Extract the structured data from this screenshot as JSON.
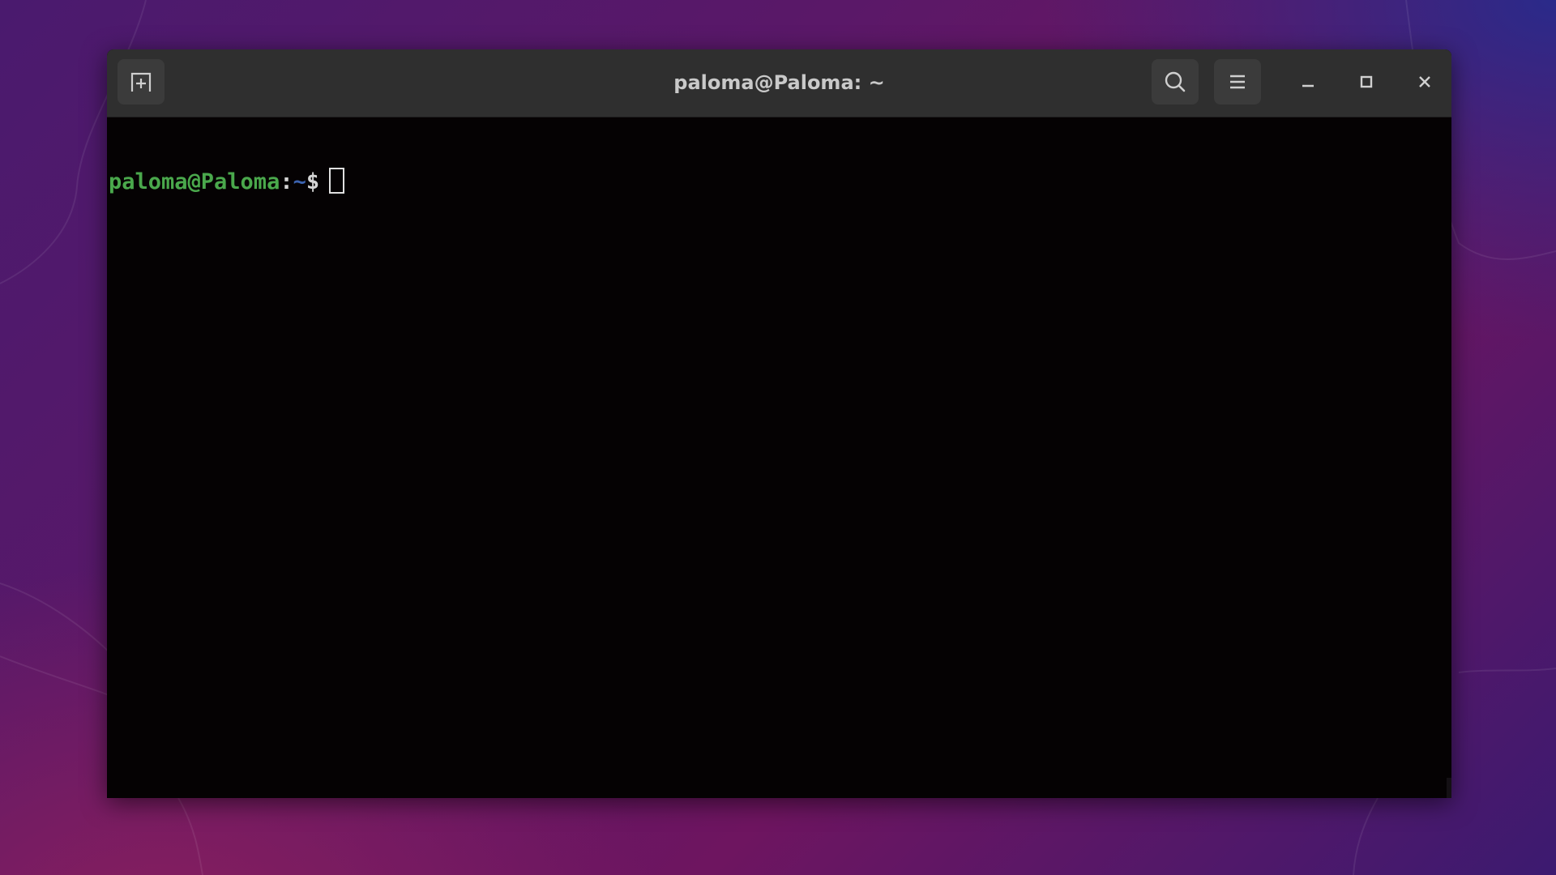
{
  "window": {
    "title": "paloma@Paloma: ~"
  },
  "headerbar": {
    "icons": {
      "new_tab": "new-tab-icon",
      "search": "search-icon",
      "menu": "hamburger-menu-icon",
      "minimize": "minimize-icon",
      "maximize": "maximize-icon",
      "close": "close-icon"
    }
  },
  "terminal": {
    "prompt": {
      "user_host": "paloma@Paloma",
      "separator": ":",
      "path": "~",
      "symbol": "$"
    }
  },
  "colors": {
    "prompt_user": "#4aa84c",
    "prompt_path": "#3c63b0",
    "terminal_bg": "#050203",
    "headerbar_bg": "#2f2f2f"
  }
}
